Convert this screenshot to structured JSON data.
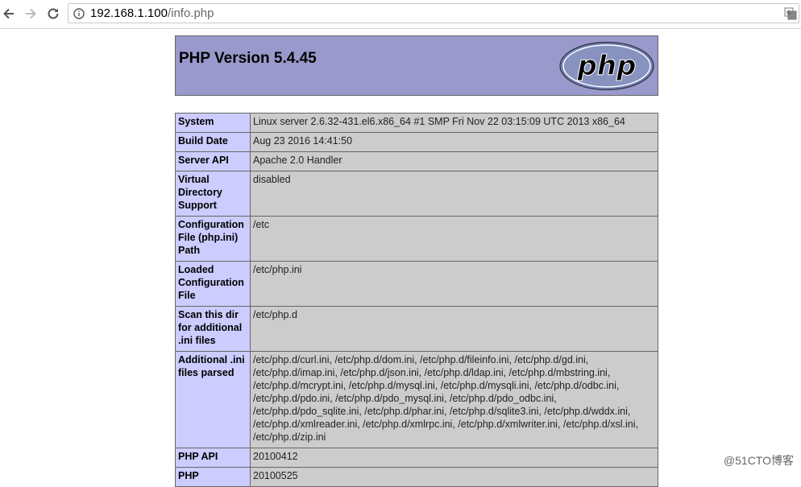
{
  "browser": {
    "url_host": "192.168.1.100",
    "url_path": "/info.php"
  },
  "header": {
    "title": "PHP Version 5.4.45",
    "logo_text": "php"
  },
  "rows": [
    {
      "label": "System",
      "value": "Linux server 2.6.32-431.el6.x86_64 #1 SMP Fri Nov 22 03:15:09 UTC 2013 x86_64"
    },
    {
      "label": "Build Date",
      "value": "Aug 23 2016 14:41:50"
    },
    {
      "label": "Server API",
      "value": "Apache 2.0 Handler"
    },
    {
      "label": "Virtual Directory Support",
      "value": "disabled"
    },
    {
      "label": "Configuration File (php.ini) Path",
      "value": "/etc"
    },
    {
      "label": "Loaded Configuration File",
      "value": "/etc/php.ini"
    },
    {
      "label": "Scan this dir for additional .ini files",
      "value": "/etc/php.d"
    },
    {
      "label": "Additional .ini files parsed",
      "value": "/etc/php.d/curl.ini, /etc/php.d/dom.ini, /etc/php.d/fileinfo.ini, /etc/php.d/gd.ini, /etc/php.d/imap.ini, /etc/php.d/json.ini, /etc/php.d/ldap.ini, /etc/php.d/mbstring.ini, /etc/php.d/mcrypt.ini, /etc/php.d/mysql.ini, /etc/php.d/mysqli.ini, /etc/php.d/odbc.ini, /etc/php.d/pdo.ini, /etc/php.d/pdo_mysql.ini, /etc/php.d/pdo_odbc.ini, /etc/php.d/pdo_sqlite.ini, /etc/php.d/phar.ini, /etc/php.d/sqlite3.ini, /etc/php.d/wddx.ini, /etc/php.d/xmlreader.ini, /etc/php.d/xmlrpc.ini, /etc/php.d/xmlwriter.ini, /etc/php.d/xsl.ini, /etc/php.d/zip.ini"
    },
    {
      "label": "PHP API",
      "value": "20100412"
    },
    {
      "label": "PHP",
      "value": "20100525"
    }
  ],
  "watermark": "@51CTO博客",
  "colors": {
    "header_bg": "#9999cc",
    "label_bg": "#ccccff",
    "value_bg": "#cccccc"
  }
}
